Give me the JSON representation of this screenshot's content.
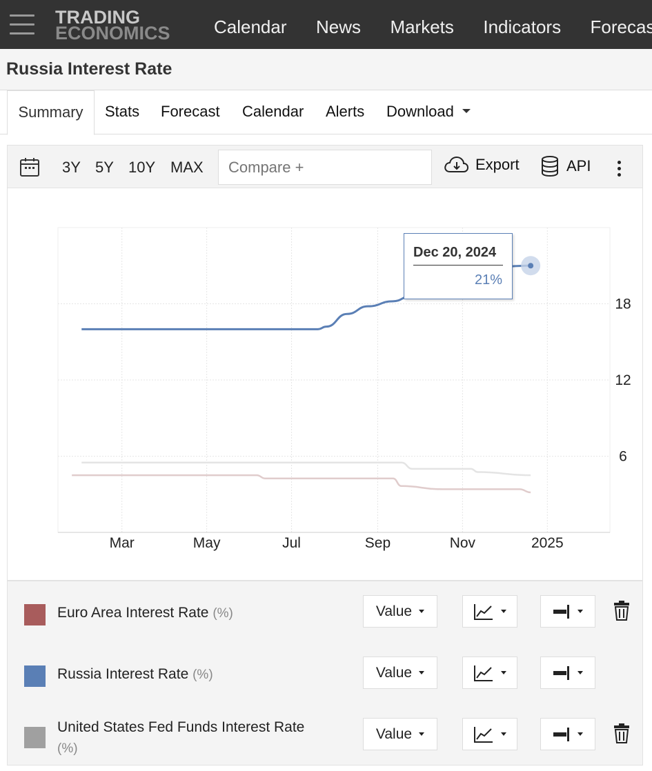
{
  "nav": {
    "logo_line1": "TRADING",
    "logo_line2": "ECONOMICS",
    "links": [
      "Calendar",
      "News",
      "Markets",
      "Indicators",
      "Forecast"
    ]
  },
  "page_title": "Russia Interest Rate",
  "tabs": [
    {
      "label": "Summary",
      "active": true
    },
    {
      "label": "Stats"
    },
    {
      "label": "Forecast"
    },
    {
      "label": "Calendar"
    },
    {
      "label": "Alerts"
    },
    {
      "label": "Download"
    }
  ],
  "toolbar": {
    "ranges": [
      "3Y",
      "5Y",
      "10Y",
      "MAX"
    ],
    "compare_placeholder": "Compare +",
    "export_label": "Export",
    "api_label": "API"
  },
  "tooltip": {
    "date": "Dec 20, 2024",
    "value": "21%"
  },
  "colors": {
    "russia": "#5a7fb5",
    "euro": "#a85c5c",
    "us": "#a0a0a0"
  },
  "chart_data": {
    "type": "line",
    "x_tick_labels": [
      "Mar",
      "May",
      "Jul",
      "Sep",
      "Nov",
      "2025"
    ],
    "y_tick_labels": [
      "18",
      "12",
      "6"
    ],
    "ylim": [
      0,
      24
    ],
    "series": [
      {
        "name": "Russia Interest Rate",
        "points": [
          [
            "2024-02-01",
            16
          ],
          [
            "2024-07-20",
            16
          ],
          [
            "2024-07-26",
            16.2
          ],
          [
            "2024-08-10",
            17.2
          ],
          [
            "2024-08-25",
            17.8
          ],
          [
            "2024-09-12",
            18.2
          ],
          [
            "2024-09-25",
            18.6
          ],
          [
            "2024-10-10",
            19.4
          ],
          [
            "2024-10-25",
            20.3
          ],
          [
            "2024-11-10",
            20.8
          ],
          [
            "2024-12-20",
            21
          ]
        ]
      },
      {
        "name": "Euro Area Interest Rate",
        "points": [
          [
            "2024-01-25",
            4.5
          ],
          [
            "2024-06-06",
            4.5
          ],
          [
            "2024-06-12",
            4.25
          ],
          [
            "2024-09-12",
            4.25
          ],
          [
            "2024-09-18",
            3.65
          ],
          [
            "2024-10-17",
            3.4
          ],
          [
            "2024-12-12",
            3.4
          ],
          [
            "2024-12-20",
            3.15
          ]
        ]
      },
      {
        "name": "United States Fed Funds Interest Rate",
        "points": [
          [
            "2024-02-01",
            5.5
          ],
          [
            "2024-09-18",
            5.5
          ],
          [
            "2024-09-26",
            5.0
          ],
          [
            "2024-11-07",
            5.0
          ],
          [
            "2024-11-12",
            4.75
          ],
          [
            "2024-12-20",
            4.5
          ]
        ]
      }
    ]
  },
  "legend": [
    {
      "name": "Euro Area Interest Rate",
      "unit": "(%)",
      "color": "#a85c5c",
      "value_label": "Value",
      "deletable": true
    },
    {
      "name": "Russia Interest Rate",
      "unit": "(%)",
      "color": "#5a7fb5",
      "value_label": "Value",
      "deletable": false
    },
    {
      "name": "United States Fed Funds Interest Rate",
      "unit": "(%)",
      "color": "#a0a0a0",
      "value_label": "Value",
      "deletable": true
    }
  ]
}
